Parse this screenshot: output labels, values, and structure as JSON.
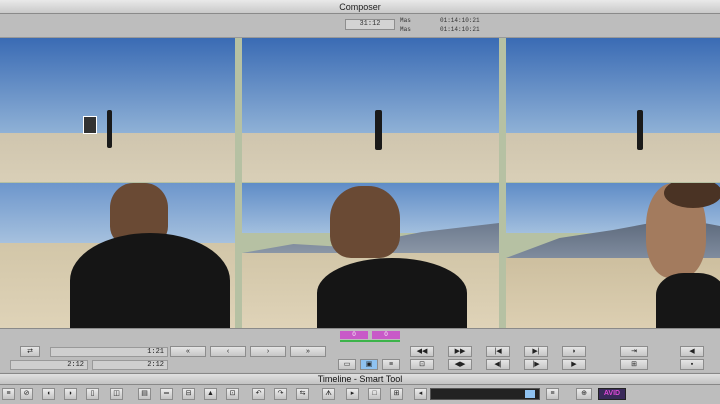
{
  "window": {
    "title": "Composer"
  },
  "timecode": {
    "duration": "31:12",
    "rows": [
      {
        "label": "Mas",
        "value": "01:14:10:21"
      },
      {
        "label": "Mas",
        "value": "01:14:10:21"
      }
    ]
  },
  "controls": {
    "field_top": "1:21",
    "field_bottom_a": "2:12",
    "field_bottom_b": "2:12",
    "marker_a": "0",
    "marker_b": "0",
    "transport_left": [
      "«",
      "‹",
      "›",
      "»"
    ]
  },
  "timeline": {
    "title": "Timeline - Smart Tool"
  },
  "toolbar": {
    "brand": "AVID"
  },
  "colors": {
    "marker": "#c85ac8",
    "meter": "#8fc2f0",
    "sky_top": "#3e6fb6",
    "sand": "#d8cdb4"
  }
}
